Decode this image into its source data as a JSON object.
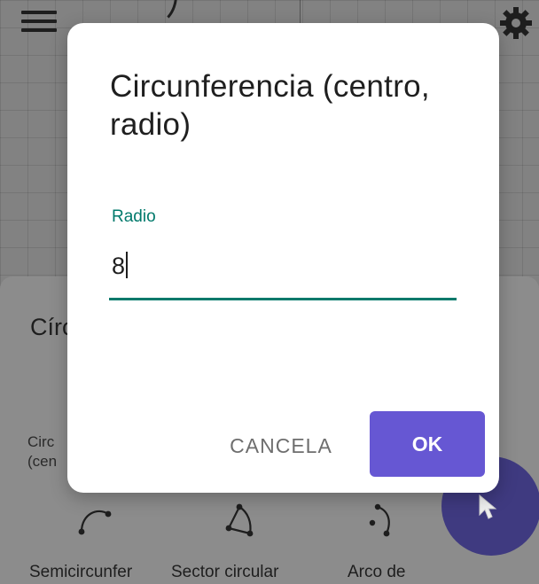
{
  "dialog": {
    "title": "Circunferencia (centro, radio)",
    "field_label": "Radio",
    "field_value": "8",
    "cancel_label": "CANCELA",
    "ok_label": "OK"
  },
  "background": {
    "panel_title": "Círc",
    "panel_item_line1": "Circ",
    "panel_item_line2": "(cen",
    "tools": [
      {
        "label": "Semicircunfer",
        "icon": "semicircle-icon"
      },
      {
        "label": "Sector circular",
        "icon": "circular-sector-icon"
      },
      {
        "label": "Arco de",
        "icon": "arc-icon"
      }
    ]
  },
  "colors": {
    "accent_teal": "#00796b",
    "ok_button": "#6657d3",
    "fab": "#3f3a80"
  }
}
